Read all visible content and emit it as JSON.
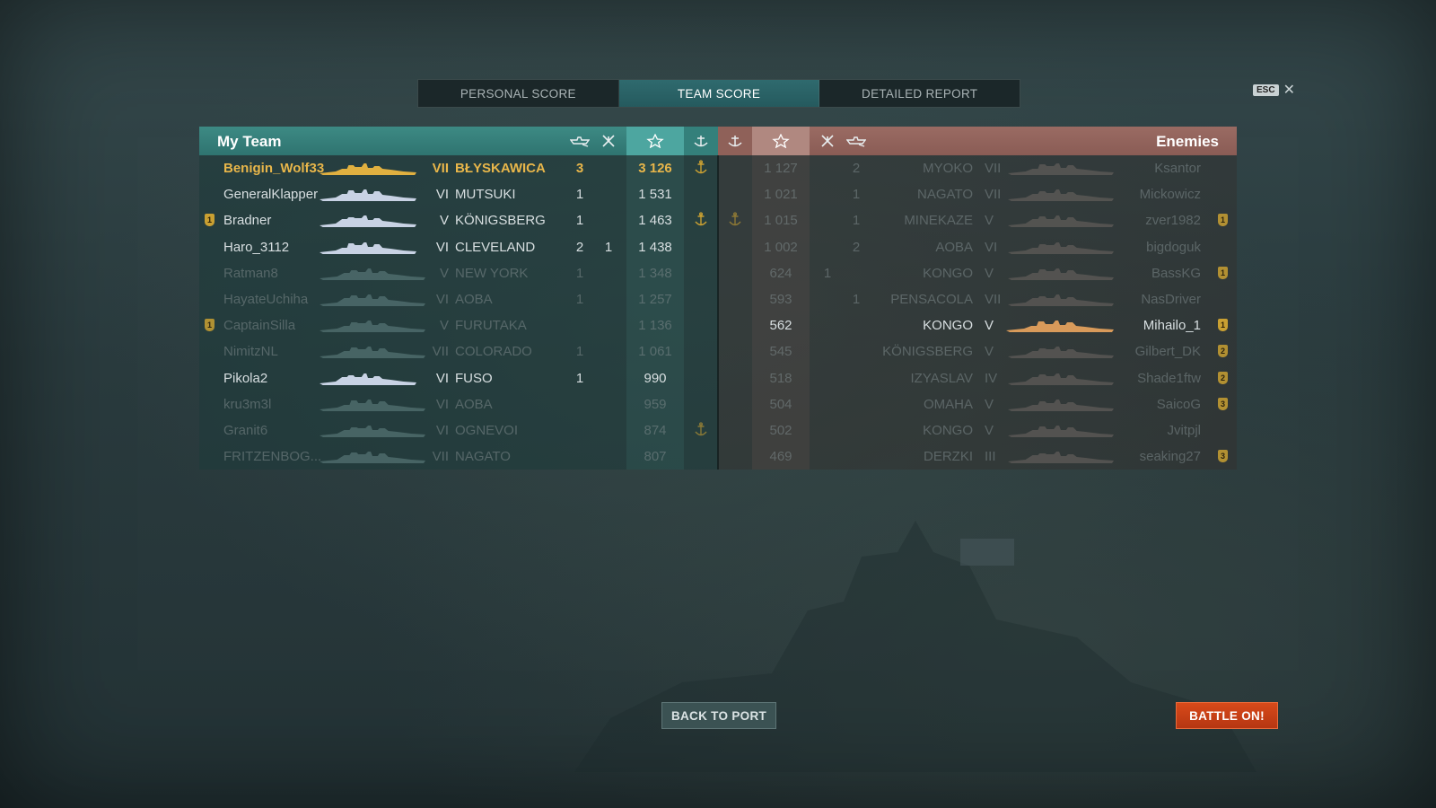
{
  "tabs": [
    {
      "label": "PERSONAL SCORE",
      "active": false
    },
    {
      "label": "TEAM SCORE",
      "active": true
    },
    {
      "label": "DETAILED REPORT",
      "active": false
    }
  ],
  "esc": {
    "key": "ESC",
    "close": "✕"
  },
  "my_team": {
    "title": "My Team",
    "players": [
      {
        "name": "Benigin_Wolf33",
        "tier": "VII",
        "ship": "BŁYSKAWICA",
        "kills": "3",
        "planes": "",
        "score": "3 126",
        "base": true,
        "medal": "",
        "state": "hl"
      },
      {
        "name": "GeneralKlapper",
        "tier": "VI",
        "ship": "MUTSUKI",
        "kills": "1",
        "planes": "",
        "score": "1 531",
        "base": false,
        "medal": "",
        "state": "normal"
      },
      {
        "name": "Bradner",
        "tier": "V",
        "ship": "KÖNIGSBERG",
        "kills": "1",
        "planes": "",
        "score": "1 463",
        "base": true,
        "medal": "1",
        "state": "normal"
      },
      {
        "name": "Haro_3112",
        "tier": "VI",
        "ship": "CLEVELAND",
        "kills": "2",
        "planes": "1",
        "score": "1 438",
        "base": false,
        "medal": "",
        "state": "normal"
      },
      {
        "name": "Ratman8",
        "tier": "V",
        "ship": "NEW YORK",
        "kills": "1",
        "planes": "",
        "score": "1 348",
        "base": false,
        "medal": "",
        "state": "dim"
      },
      {
        "name": "HayateUchiha",
        "tier": "VI",
        "ship": "AOBA",
        "kills": "1",
        "planes": "",
        "score": "1 257",
        "base": false,
        "medal": "",
        "state": "dim"
      },
      {
        "name": "CaptainSilla",
        "tier": "V",
        "ship": "FURUTAKA",
        "kills": "",
        "planes": "",
        "score": "1 136",
        "base": false,
        "medal": "1",
        "state": "dim"
      },
      {
        "name": "NimitzNL",
        "tier": "VII",
        "ship": "COLORADO",
        "kills": "1",
        "planes": "",
        "score": "1 061",
        "base": false,
        "medal": "",
        "state": "dim"
      },
      {
        "name": "Pikola2",
        "tier": "VI",
        "ship": "FUSO",
        "kills": "1",
        "planes": "",
        "score": "990",
        "base": false,
        "medal": "",
        "state": "normal"
      },
      {
        "name": "kru3m3l",
        "tier": "VI",
        "ship": "AOBA",
        "kills": "",
        "planes": "",
        "score": "959",
        "base": false,
        "medal": "",
        "state": "dim"
      },
      {
        "name": "Granit6",
        "tier": "VI",
        "ship": "OGNEVOI",
        "kills": "",
        "planes": "",
        "score": "874",
        "base": true,
        "medal": "",
        "state": "dim"
      },
      {
        "name": "FRITZENBOG...",
        "tier": "VII",
        "ship": "NAGATO",
        "kills": "",
        "planes": "",
        "score": "807",
        "base": false,
        "medal": "",
        "state": "dim"
      }
    ]
  },
  "enemies": {
    "title": "Enemies",
    "players": [
      {
        "name": "Ksantor",
        "tier": "VII",
        "ship": "MYOKO",
        "kills": "2",
        "planes": "",
        "score": "1 127",
        "base": false,
        "medal": "",
        "state": "dim"
      },
      {
        "name": "Mickowicz",
        "tier": "VII",
        "ship": "NAGATO",
        "kills": "1",
        "planes": "",
        "score": "1 021",
        "base": false,
        "medal": "",
        "state": "dim"
      },
      {
        "name": "zver1982",
        "tier": "V",
        "ship": "MINEKAZE",
        "kills": "1",
        "planes": "",
        "score": "1 015",
        "base": true,
        "medal": "1",
        "state": "dim"
      },
      {
        "name": "bigdoguk",
        "tier": "VI",
        "ship": "AOBA",
        "kills": "2",
        "planes": "",
        "score": "1 002",
        "base": false,
        "medal": "",
        "state": "dim"
      },
      {
        "name": "BassKG",
        "tier": "V",
        "ship": "KONGO",
        "kills": "",
        "planes": "1",
        "score": "624",
        "base": false,
        "medal": "1",
        "state": "dim"
      },
      {
        "name": "NasDriver",
        "tier": "VII",
        "ship": "PENSACOLA",
        "kills": "1",
        "planes": "",
        "score": "593",
        "base": false,
        "medal": "",
        "state": "dim"
      },
      {
        "name": "Mihailo_1",
        "tier": "V",
        "ship": "KONGO",
        "kills": "",
        "planes": "",
        "score": "562",
        "base": false,
        "medal": "1",
        "state": "normal"
      },
      {
        "name": "Gilbert_DK",
        "tier": "V",
        "ship": "KÖNIGSBERG",
        "kills": "",
        "planes": "",
        "score": "545",
        "base": false,
        "medal": "2",
        "state": "dim"
      },
      {
        "name": "Shade1ftw",
        "tier": "IV",
        "ship": "IZYASLAV",
        "kills": "",
        "planes": "",
        "score": "518",
        "base": false,
        "medal": "2",
        "state": "dim"
      },
      {
        "name": "SaicoG",
        "tier": "V",
        "ship": "OMAHA",
        "kills": "",
        "planes": "",
        "score": "504",
        "base": false,
        "medal": "3",
        "state": "dim"
      },
      {
        "name": "Jvitpjl",
        "tier": "V",
        "ship": "KONGO",
        "kills": "",
        "planes": "",
        "score": "502",
        "base": false,
        "medal": "",
        "state": "dim"
      },
      {
        "name": "seaking27",
        "tier": "III",
        "ship": "DERZKI",
        "kills": "",
        "planes": "",
        "score": "469",
        "base": false,
        "medal": "3",
        "state": "dim"
      }
    ]
  },
  "buttons": {
    "back_to_port": "BACK TO PORT",
    "battle_on": "BATTLE ON!"
  },
  "colors": {
    "my_team_header": "#3d8a84",
    "enemy_header": "#9a6b63",
    "highlight": "#e8b64a",
    "battle_button": "#d84a1a",
    "medal": "#c9a032"
  },
  "icons": {
    "kills": "ship-destroyed-icon",
    "planes": "plane-destroyed-icon",
    "score": "star-icon",
    "base": "anchor-icon",
    "close": "close-icon"
  }
}
